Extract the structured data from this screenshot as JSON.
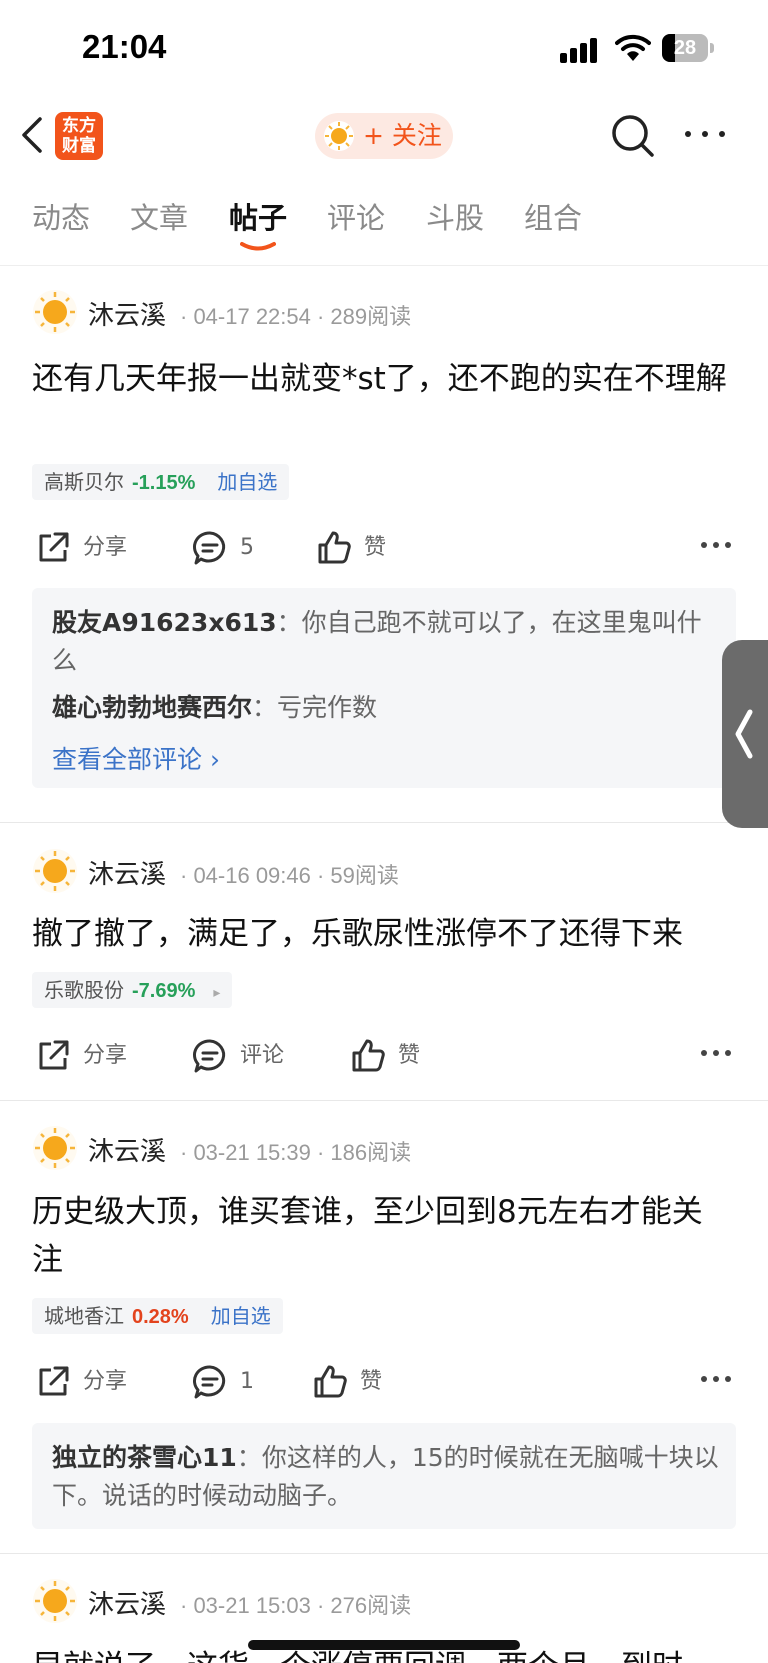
{
  "status_bar": {
    "time": "21:04",
    "battery": "28",
    "battery_level": 0.28
  },
  "nav": {
    "logo_line1": "东方",
    "logo_line2": "财富",
    "follow_label": "+ 关注"
  },
  "tabs": [
    {
      "label": "动态"
    },
    {
      "label": "文章"
    },
    {
      "label": "帖子",
      "active": true
    },
    {
      "label": "评论"
    },
    {
      "label": "斗股"
    },
    {
      "label": "组合"
    }
  ],
  "posts": [
    {
      "author": "沐云溪",
      "meta": "· 04-17 22:54 · 289阅读",
      "text": "还有几天年报一出就变*st了，还不跑的实在不理解",
      "stock": {
        "name": "高斯贝尔",
        "change": "-1.15%",
        "add": "加自选"
      },
      "actions": {
        "share": "分享",
        "comment": "5",
        "like": "赞"
      },
      "comments": [
        {
          "user": "股友A91623x613",
          "sep": "：",
          "text": "你自己跑不就可以了，在这里鬼叫什么"
        },
        {
          "user": "雄心勃勃地赛西尔",
          "sep": "：",
          "text": "亏完作数"
        }
      ],
      "view_all": "查看全部评论 ›"
    },
    {
      "author": "沐云溪",
      "meta": "· 04-16 09:46 · 59阅读",
      "text": "撤了撤了，满足了，乐歌尿性涨停不了还得下来",
      "stock": {
        "name": "乐歌股份",
        "change": "-7.69%",
        "arrow": "▸"
      },
      "actions": {
        "share": "分享",
        "comment": "评论",
        "like": "赞"
      }
    },
    {
      "author": "沐云溪",
      "meta": "· 03-21 15:39 · 186阅读",
      "text": "历史级大顶，谁买套谁，至少回到8元左右才能关注",
      "stock": {
        "name": "城地香江",
        "change": "0.28%",
        "add": "加自选"
      },
      "actions": {
        "share": "分享",
        "comment": "1",
        "like": "赞"
      },
      "comments": [
        {
          "user": "独立的茶雪心11",
          "sep": "：",
          "text": "你这样的人，15的时候就在无脑喊十块以下。说话的时候动动脑子。"
        }
      ]
    },
    {
      "author": "沐云溪",
      "meta": "· 03-21 15:03 · 276阅读",
      "text": "早就说了，这货一个涨停要回调一两个月，到时"
    }
  ],
  "colors": {
    "brand": "#f2541b",
    "down": "#27a05a",
    "up": "#e3431d",
    "link": "#3b73c8"
  }
}
